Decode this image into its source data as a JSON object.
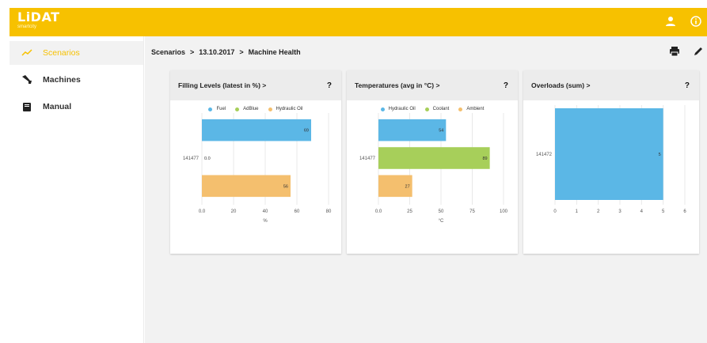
{
  "app": {
    "logo": "LiDAT",
    "logo_sub": "smartcity"
  },
  "colors": {
    "brand": "#f7c100",
    "fuel": "#5bb7e6",
    "adblue": "#a7cf5a",
    "hydraulic": "#f4bf6e"
  },
  "topbar": {
    "icons": [
      "user-icon",
      "info-icon"
    ]
  },
  "sidebar": {
    "items": [
      {
        "label": "Scenarios",
        "icon": "trend-icon",
        "active": true
      },
      {
        "label": "Machines",
        "icon": "excavator-icon",
        "active": false
      },
      {
        "label": "Manual",
        "icon": "book-icon",
        "active": false
      }
    ]
  },
  "breadcrumb": {
    "items": [
      "Scenarios",
      "13.10.2017",
      "Machine Health"
    ],
    "sep": ">"
  },
  "actions": {
    "icons": [
      "print-icon",
      "edit-icon"
    ]
  },
  "cards": [
    {
      "title": "Filling Levels (latest in %)",
      "chevron": ">",
      "help": "?"
    },
    {
      "title": "Temperatures (avg in °C)",
      "chevron": ">",
      "help": "?"
    },
    {
      "title": "Overloads (sum)",
      "chevron": ">",
      "help": "?"
    }
  ],
  "chart_data": [
    {
      "type": "bar",
      "orientation": "horizontal",
      "title": "Filling Levels (latest in %)",
      "categories": [
        "141477"
      ],
      "series": [
        {
          "name": "Fuel",
          "values": [
            69
          ],
          "color": "#5bb7e6",
          "label": "69"
        },
        {
          "name": "AdBlue",
          "values": [
            0
          ],
          "color": "#a7cf5a",
          "label": "0.0"
        },
        {
          "name": "Hydraulic Oil",
          "values": [
            56
          ],
          "color": "#f4bf6e",
          "label": "56"
        }
      ],
      "xlim": [
        0,
        80
      ],
      "xticks": [
        "0.0",
        "20",
        "40",
        "60",
        "80"
      ],
      "xlabel": "%",
      "legend": "top"
    },
    {
      "type": "bar",
      "orientation": "horizontal",
      "title": "Temperatures (avg in °C)",
      "categories": [
        "141477"
      ],
      "series": [
        {
          "name": "Hydraulic Oil",
          "values": [
            54
          ],
          "color": "#5bb7e6",
          "label": "54"
        },
        {
          "name": "Coolant",
          "values": [
            89
          ],
          "color": "#a7cf5a",
          "label": "89"
        },
        {
          "name": "Ambient",
          "values": [
            27
          ],
          "color": "#f4bf6e",
          "label": "27"
        }
      ],
      "xlim": [
        0,
        100
      ],
      "xticks": [
        "0.0",
        "25",
        "50",
        "75",
        "100"
      ],
      "xlabel": "°C",
      "legend": "top"
    },
    {
      "type": "bar",
      "orientation": "horizontal",
      "title": "Overloads (sum)",
      "categories": [
        "141472"
      ],
      "series": [
        {
          "values": [
            5
          ],
          "color": "#5bb7e6",
          "label": "5"
        }
      ],
      "xlim": [
        0,
        6
      ],
      "xticks": [
        "0",
        "1",
        "2",
        "3",
        "4",
        "5",
        "6"
      ],
      "xlabel": "",
      "legend": "none"
    }
  ]
}
